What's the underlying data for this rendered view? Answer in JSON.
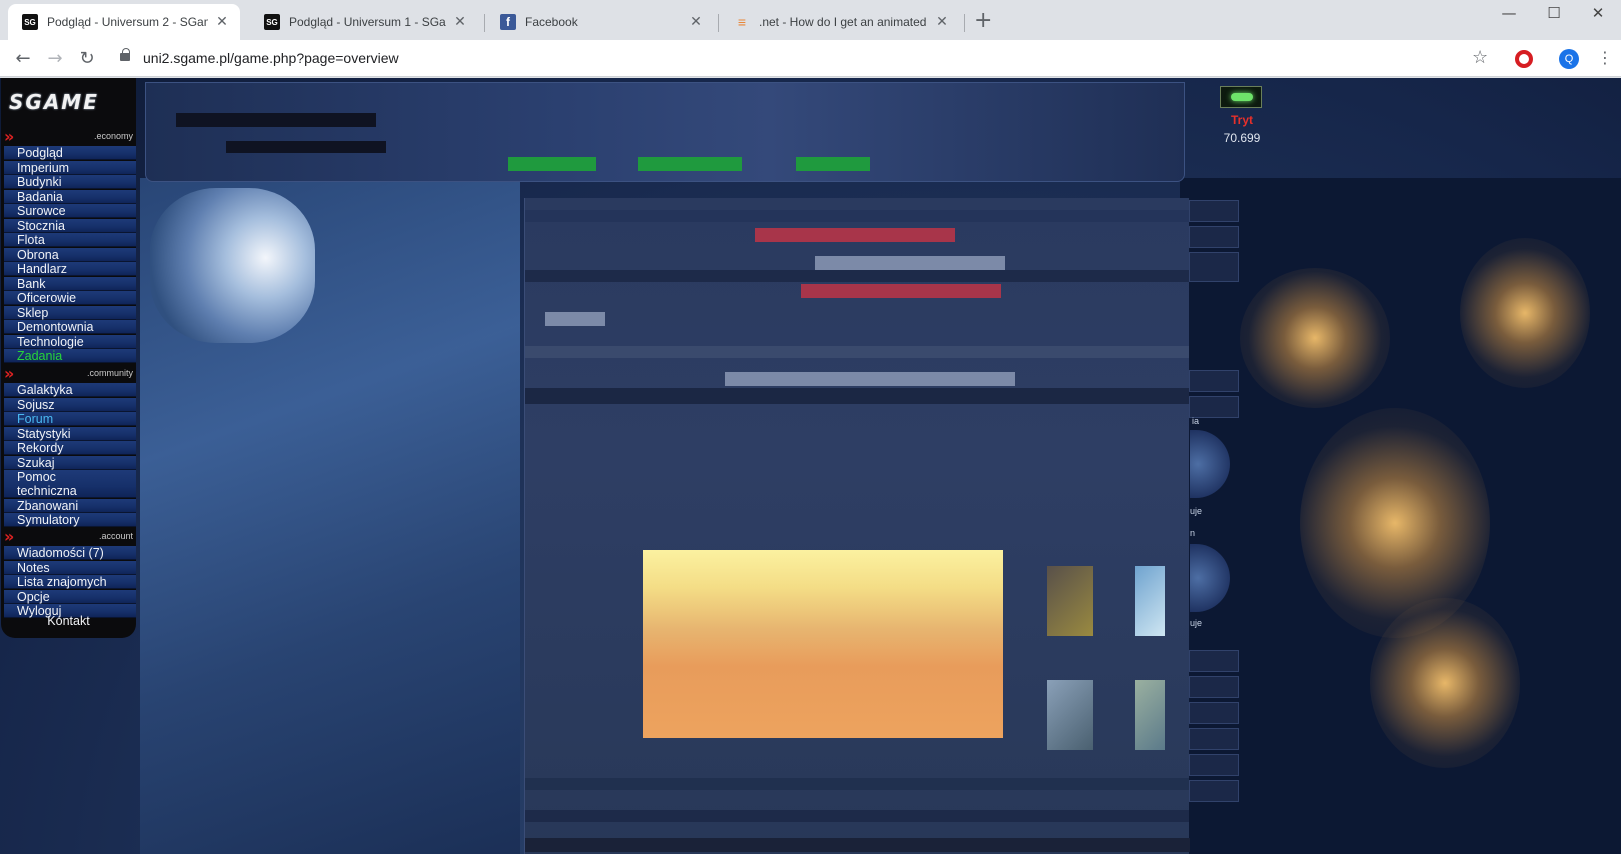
{
  "browser": {
    "tabs": [
      {
        "title": "Podgląd - Universum 2 - SGame",
        "favicon": "sgame",
        "active": true
      },
      {
        "title": "Podgląd - Universum 1 - SGame",
        "favicon": "sgame",
        "active": false
      },
      {
        "title": "Facebook",
        "favicon": "facebook",
        "active": false
      },
      {
        "title": ".net - How do I get an animated",
        "favicon": "stackoverflow",
        "active": false
      }
    ],
    "close_glyph": "✕",
    "new_tab_glyph": "+",
    "window_controls": {
      "minimize": "—",
      "maximize": "☐",
      "close": "✕"
    },
    "nav": {
      "back": "←",
      "forward": "→",
      "reload": "↻"
    },
    "url": "uni2.sgame.pl/game.php?page=overview",
    "bookmark_glyph": "☆",
    "profile_initial": "Q",
    "menu_glyph": "⋮",
    "favicon_text": {
      "sgame": "SG",
      "facebook": "f",
      "stackoverflow": "≡"
    }
  },
  "game": {
    "logo": "SGAME",
    "resource": {
      "name": "Tryt",
      "value": "70.699"
    },
    "sections": [
      {
        "label": ".economy",
        "items": [
          {
            "label": "Podgląd"
          },
          {
            "label": "Imperium"
          },
          {
            "label": "Budynki"
          },
          {
            "label": "Badania"
          },
          {
            "label": "Surowce"
          },
          {
            "label": "Stocznia"
          },
          {
            "label": "Flota"
          },
          {
            "label": "Obrona"
          },
          {
            "label": "Handlarz"
          },
          {
            "label": "Bank"
          },
          {
            "label": "Oficerowie"
          },
          {
            "label": "Sklep"
          },
          {
            "label": "Demontownia"
          },
          {
            "label": "Technologie"
          },
          {
            "label": "Zadania",
            "color": "green"
          }
        ]
      },
      {
        "label": ".community",
        "items": [
          {
            "label": "Galaktyka"
          },
          {
            "label": "Sojusz"
          },
          {
            "label": "Forum",
            "color": "cyan"
          },
          {
            "label": "Statystyki"
          },
          {
            "label": "Rekordy"
          },
          {
            "label": "Szukaj"
          },
          {
            "label": "Pomoc techniczna"
          },
          {
            "label": "Zbanowani"
          },
          {
            "label": "Symulatory"
          }
        ]
      },
      {
        "label": ".account",
        "items": [
          {
            "label": "Wiadomości (7)"
          },
          {
            "label": "Notes"
          },
          {
            "label": "Lista znajomych"
          },
          {
            "label": "Opcje"
          },
          {
            "label": "Wyloguj"
          }
        ]
      }
    ],
    "kontakt": "Kontakt",
    "side_labels": {
      "a": "ia",
      "b": "uje",
      "c": "n",
      "d": "uje"
    },
    "section_chevron": "»"
  },
  "colors": {
    "accent_red": "#d22222",
    "menu_blue": "#16306a",
    "zadania_green": "#26d63a",
    "forum_cyan": "#4ab8f0",
    "tryt_red": "#e8302a"
  }
}
